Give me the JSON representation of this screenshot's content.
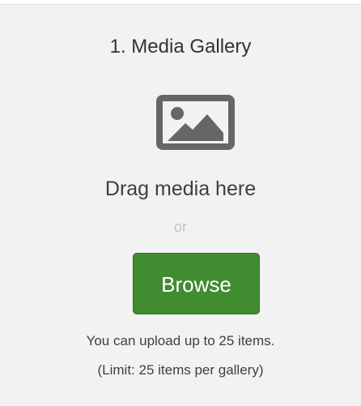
{
  "gallery": {
    "title": "1. Media Gallery",
    "icon": "image-icon",
    "drag_text": "Drag media here",
    "or_text": "or",
    "browse_label": "Browse",
    "upload_info": "You can upload up to 25 items.",
    "limit_info": "(Limit: 25 items per gallery)"
  },
  "colors": {
    "panel_background": "#f2f2f2",
    "accent_button": "#418b31",
    "icon_gray": "#666666"
  }
}
